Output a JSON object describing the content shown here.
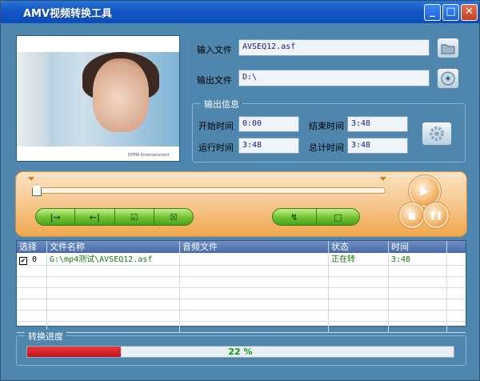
{
  "window": {
    "title": "AMV视频转换工具",
    "minimize": "_",
    "maximize": "□",
    "close": "✕"
  },
  "files": {
    "input_label": "输入文件",
    "input_value": "AVSEQ12.asf",
    "output_label": "输出文件",
    "output_value": "D:\\"
  },
  "info": {
    "title": "输出信息",
    "start_label": "开始时间",
    "start_value": "0:00",
    "end_label": "结束时间",
    "end_value": "3:48",
    "run_label": "运行时间",
    "run_value": "3:48",
    "total_label": "总计时间",
    "total_value": "3:48"
  },
  "controls": {
    "left_buttons": [
      "|→",
      "←|",
      "☑",
      "☒"
    ],
    "right_buttons": [
      "↯",
      "□"
    ],
    "play": "▶",
    "stop": "■",
    "pause": "❚❚"
  },
  "table": {
    "headers": [
      "选择",
      "文件名称",
      "音频文件",
      "状态",
      "时间"
    ],
    "rows": [
      {
        "checked": "✔",
        "index": "0",
        "file": "G:\\mp4测试\\AVSEQ12.asf",
        "audio": "",
        "status": "正在转",
        "time": "3:48"
      }
    ]
  },
  "progress": {
    "title": "转换进度",
    "percent_text": "22 %",
    "fraction": 0.22
  },
  "video": {
    "caption": "DPMA Entertainment"
  },
  "colors": {
    "accent": "#1356c4",
    "progress": "#c01424",
    "ok_text": "#147a14"
  }
}
